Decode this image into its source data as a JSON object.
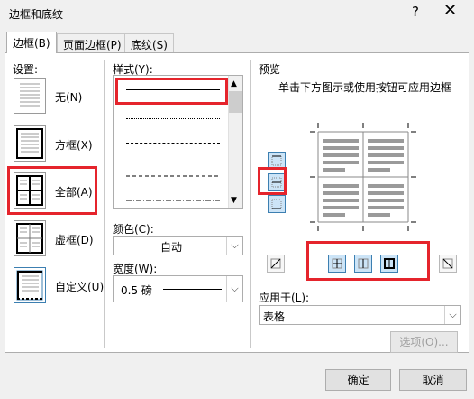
{
  "window": {
    "title": "边框和底纹",
    "help": "?",
    "close": "✕"
  },
  "tabs": [
    {
      "label": "边框(B)",
      "active": true
    },
    {
      "label": "页面边框(P)",
      "active": false
    },
    {
      "label": "底纹(S)",
      "active": false
    }
  ],
  "settings": {
    "label": "设置:",
    "items": [
      {
        "label": "无(N)",
        "icon": "setting-none-icon"
      },
      {
        "label": "方框(X)",
        "icon": "setting-box-icon"
      },
      {
        "label": "全部(A)",
        "icon": "setting-all-icon",
        "selected": true
      },
      {
        "label": "虚框(D)",
        "icon": "setting-grid-icon"
      },
      {
        "label": "自定义(U)",
        "icon": "setting-custom-icon"
      }
    ]
  },
  "style": {
    "label": "样式(Y):",
    "items": [
      "solid",
      "dotted",
      "dashed-fine",
      "dashed",
      "dash-dot"
    ],
    "selected_index": 0
  },
  "color": {
    "label": "颜色(C):",
    "value": "自动"
  },
  "width": {
    "label": "宽度(W):",
    "value": "0.5 磅"
  },
  "preview": {
    "label": "预览",
    "hint": "单击下方图示或使用按钮可应用边框"
  },
  "apply_to": {
    "label": "应用于(L):",
    "value": "表格"
  },
  "buttons": {
    "options": "选项(O)...",
    "ok": "确定",
    "cancel": "取消"
  },
  "colors": {
    "highlight": "#e5242c",
    "accent": "#3c7fb1"
  }
}
